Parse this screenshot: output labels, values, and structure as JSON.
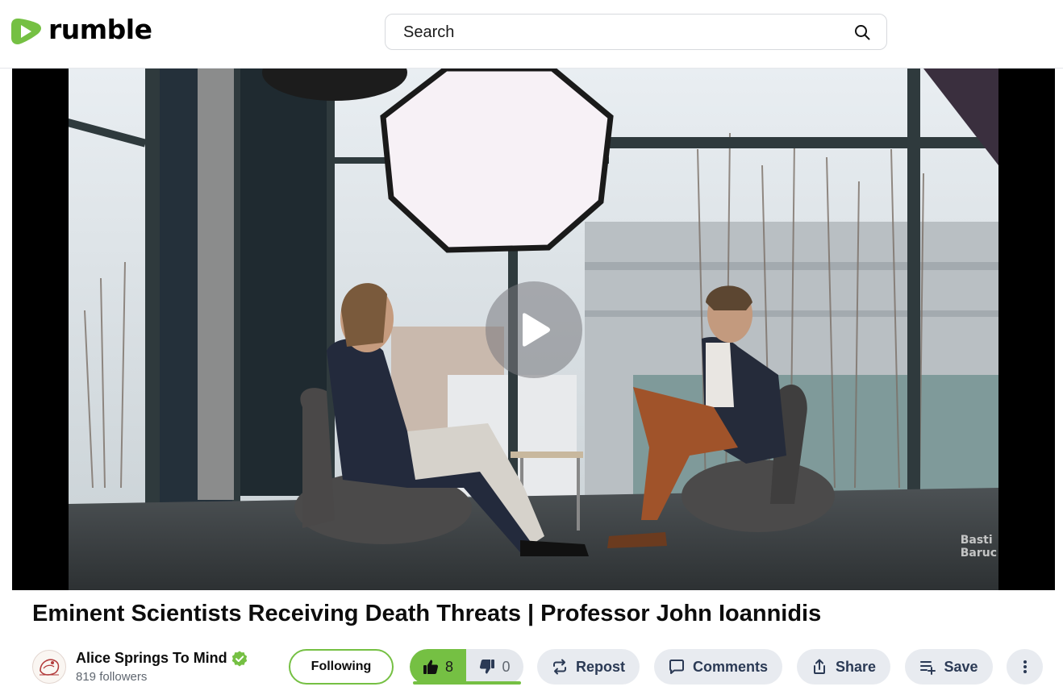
{
  "brand": {
    "name": "rumble",
    "color": "#75c043"
  },
  "search": {
    "placeholder": "Search"
  },
  "video": {
    "title": "Eminent Scientists Receiving Death Threats | Professor John Ioannidis",
    "watermark_line1": "Basti",
    "watermark_line2": "Baruc"
  },
  "channel": {
    "name": "Alice Springs To Mind",
    "verified": true,
    "followers": "819 followers",
    "follow_label": "Following"
  },
  "votes": {
    "up": "8",
    "down": "0"
  },
  "actions": {
    "repost": "Repost",
    "comments": "Comments",
    "share": "Share",
    "save": "Save"
  },
  "icons": [
    "rumble-logo-icon",
    "search-icon",
    "play-icon",
    "verified-icon",
    "thumbs-up-icon",
    "thumbs-down-icon",
    "repost-icon",
    "comment-icon",
    "share-icon",
    "playlist-add-icon",
    "more-vertical-icon"
  ]
}
